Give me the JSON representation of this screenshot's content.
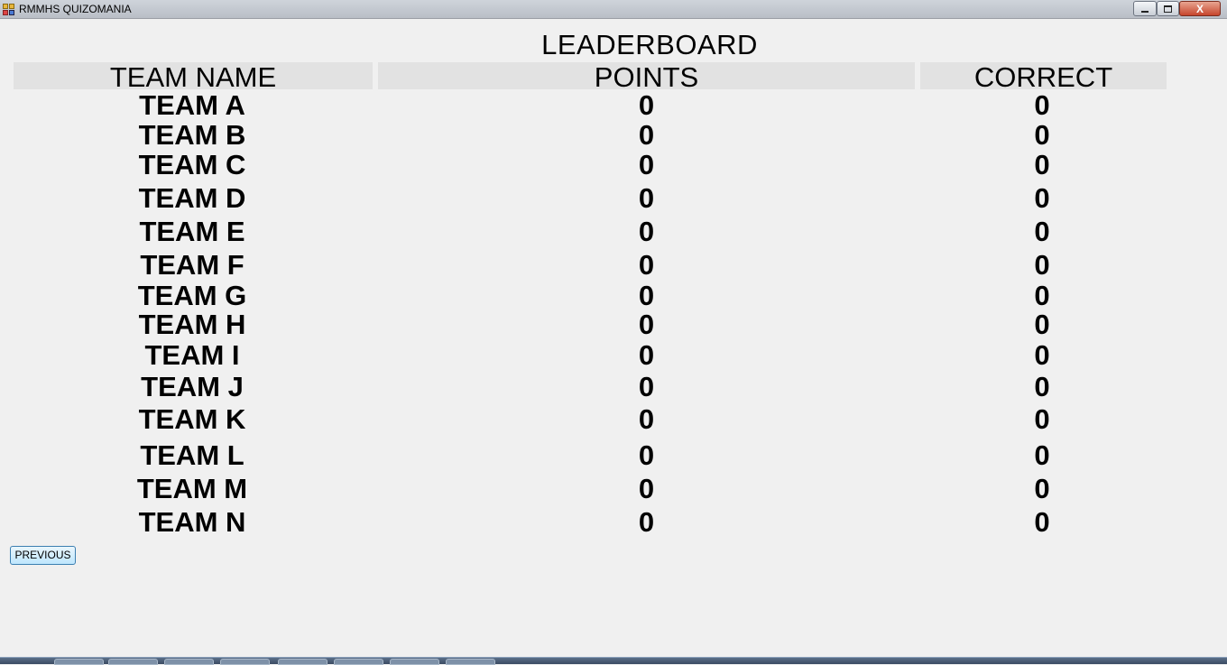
{
  "window": {
    "title": "RMMHS QUIZOMANIA",
    "close_symbol": "X"
  },
  "board": {
    "title": "LEADERBOARD",
    "columns": [
      "TEAM NAME",
      "POINTS",
      "CORRECT"
    ],
    "rows": [
      {
        "team": "TEAM A",
        "points": "0",
        "correct": "0"
      },
      {
        "team": "TEAM B",
        "points": "0",
        "correct": "0"
      },
      {
        "team": "TEAM C",
        "points": "0",
        "correct": "0"
      },
      {
        "team": "TEAM D",
        "points": "0",
        "correct": "0"
      },
      {
        "team": "TEAM E",
        "points": "0",
        "correct": "0"
      },
      {
        "team": "TEAM F",
        "points": "0",
        "correct": "0"
      },
      {
        "team": "TEAM G",
        "points": "0",
        "correct": "0"
      },
      {
        "team": "TEAM H",
        "points": "0",
        "correct": "0"
      },
      {
        "team": "TEAM I",
        "points": "0",
        "correct": "0"
      },
      {
        "team": "TEAM J",
        "points": "0",
        "correct": "0"
      },
      {
        "team": "TEAM K",
        "points": "0",
        "correct": "0"
      },
      {
        "team": "TEAM L",
        "points": "0",
        "correct": "0"
      },
      {
        "team": "TEAM M",
        "points": "0",
        "correct": "0"
      },
      {
        "team": "TEAM N",
        "points": "0",
        "correct": "0"
      }
    ]
  },
  "nav": {
    "previous_label": "PREVIOUS"
  }
}
